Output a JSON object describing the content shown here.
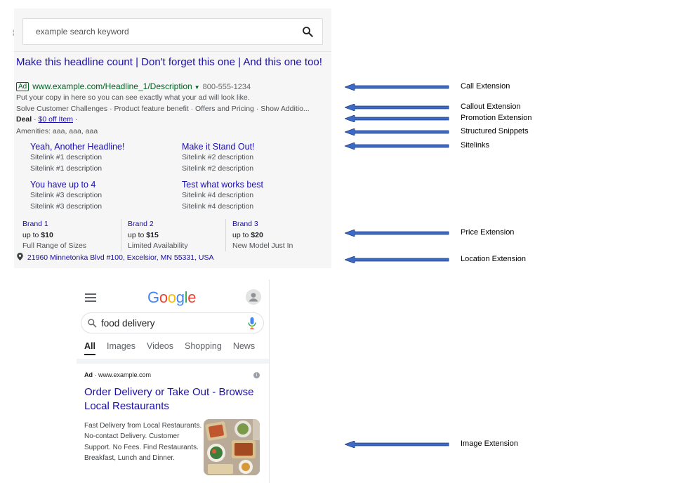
{
  "desktop": {
    "search_query": "example search keyword",
    "search_icon": "search-icon",
    "headline": "Make this headline count | Don't forget this one | And this one too!",
    "ad_label": "Ad",
    "display_url": "www.example.com/Headline_1/Description",
    "phone": "800-555-1234",
    "description": "Put your copy in here so you can see exactly what your ad will look like.",
    "callouts": "Solve Customer Challenges · Product feature benefit · Offers and Pricing · Show Additio...",
    "promotion": {
      "label": "Deal",
      "link": "$0 off Item",
      "suffix": "·"
    },
    "structured_snippet": "Amenities: aaa, aaa, aaa",
    "sitelinks": [
      {
        "title": "Yeah, Another Headline!",
        "desc1": "Sitelink #1 description",
        "desc2": "Sitelink #1 description"
      },
      {
        "title": "Make it Stand Out!",
        "desc1": "Sitelink #2 description",
        "desc2": "Sitelink #2 description"
      },
      {
        "title": "You have up to 4",
        "desc1": "Sitelink #3 description",
        "desc2": "Sitelink #3 description"
      },
      {
        "title": "Test what works best",
        "desc1": "Sitelink #4 description",
        "desc2": "Sitelink #4 description"
      }
    ],
    "prices": [
      {
        "brand": "Brand 1",
        "prefix": "up to ",
        "price": "$10",
        "detail": "Full Range of Sizes"
      },
      {
        "brand": "Brand 2",
        "prefix": "up to ",
        "price": "$15",
        "detail": "Limited Availability"
      },
      {
        "brand": "Brand 3",
        "prefix": "up to ",
        "price": "$20",
        "detail": "New Model Just In"
      }
    ],
    "location": "21960 Minnetonka Blvd #100, Excelsior, MN 55331, USA",
    "location_icon": "map-pin-icon"
  },
  "labels": {
    "call": "Call Extension",
    "callout": "Callout Extension",
    "promotion": "Promotion Extension",
    "snippets": "Structured Snippets",
    "sitelinks": "Sitelinks",
    "price": "Price Extension",
    "location": "Location Extension",
    "image": "Image Extension"
  },
  "mobile": {
    "logo": [
      "G",
      "o",
      "o",
      "g",
      "l",
      "e"
    ],
    "logo_colors": [
      "#4285F4",
      "#EA4335",
      "#FBBC05",
      "#4285F4",
      "#34A853",
      "#EA4335"
    ],
    "search_query": "food delivery",
    "tabs": [
      "All",
      "Images",
      "Videos",
      "Shopping",
      "News"
    ],
    "active_tab": "All",
    "ad_label": "Ad",
    "ad_url": " · www.example.com",
    "headline": "Order Delivery or Take Out - Browse Local Restaurants",
    "description": "Fast Delivery from Local Restaurants. No-contact Delivery. Customer Support. No Fees. Find Restaurants. Breakfast, Lunch and Dinner.",
    "info_icon": "info-icon",
    "image_icon": "food-image-icon"
  },
  "colors": {
    "link_blue": "#1a0dab",
    "url_green": "#006621",
    "arrow_blue": "#3d6ac4",
    "arrow_border": "#1f3d80"
  }
}
